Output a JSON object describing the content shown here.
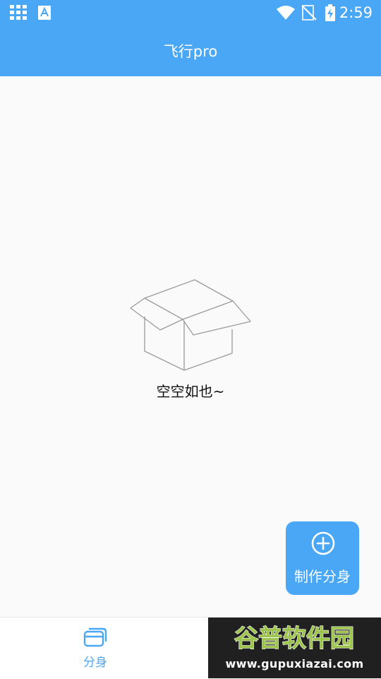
{
  "status_bar": {
    "time": "2:59",
    "icons": [
      "apps-grid-icon",
      "font-a-icon",
      "wifi-icon",
      "signal-off-icon",
      "battery-charging-icon"
    ]
  },
  "app_bar": {
    "title": "飞行pro"
  },
  "empty_state": {
    "icon": "empty-box-icon",
    "message": "空空如也~"
  },
  "fab": {
    "icon": "plus-circle-icon",
    "label": "制作分身"
  },
  "bottom_nav": {
    "items": [
      {
        "label": "分身",
        "icon": "clones-icon",
        "active": true
      },
      {
        "label": "",
        "icon": "profile-icon",
        "active": false
      }
    ]
  },
  "watermark": {
    "chinese_text": "谷普软件园",
    "url": "www.gupuxiazai.com"
  },
  "colors": {
    "primary": "#4aa7f5",
    "background": "#fafafa",
    "bottom_nav_bg": "#ffffff",
    "text_dark": "#111111",
    "watermark_bg": "#202020",
    "watermark_green": "#9cc44a"
  }
}
